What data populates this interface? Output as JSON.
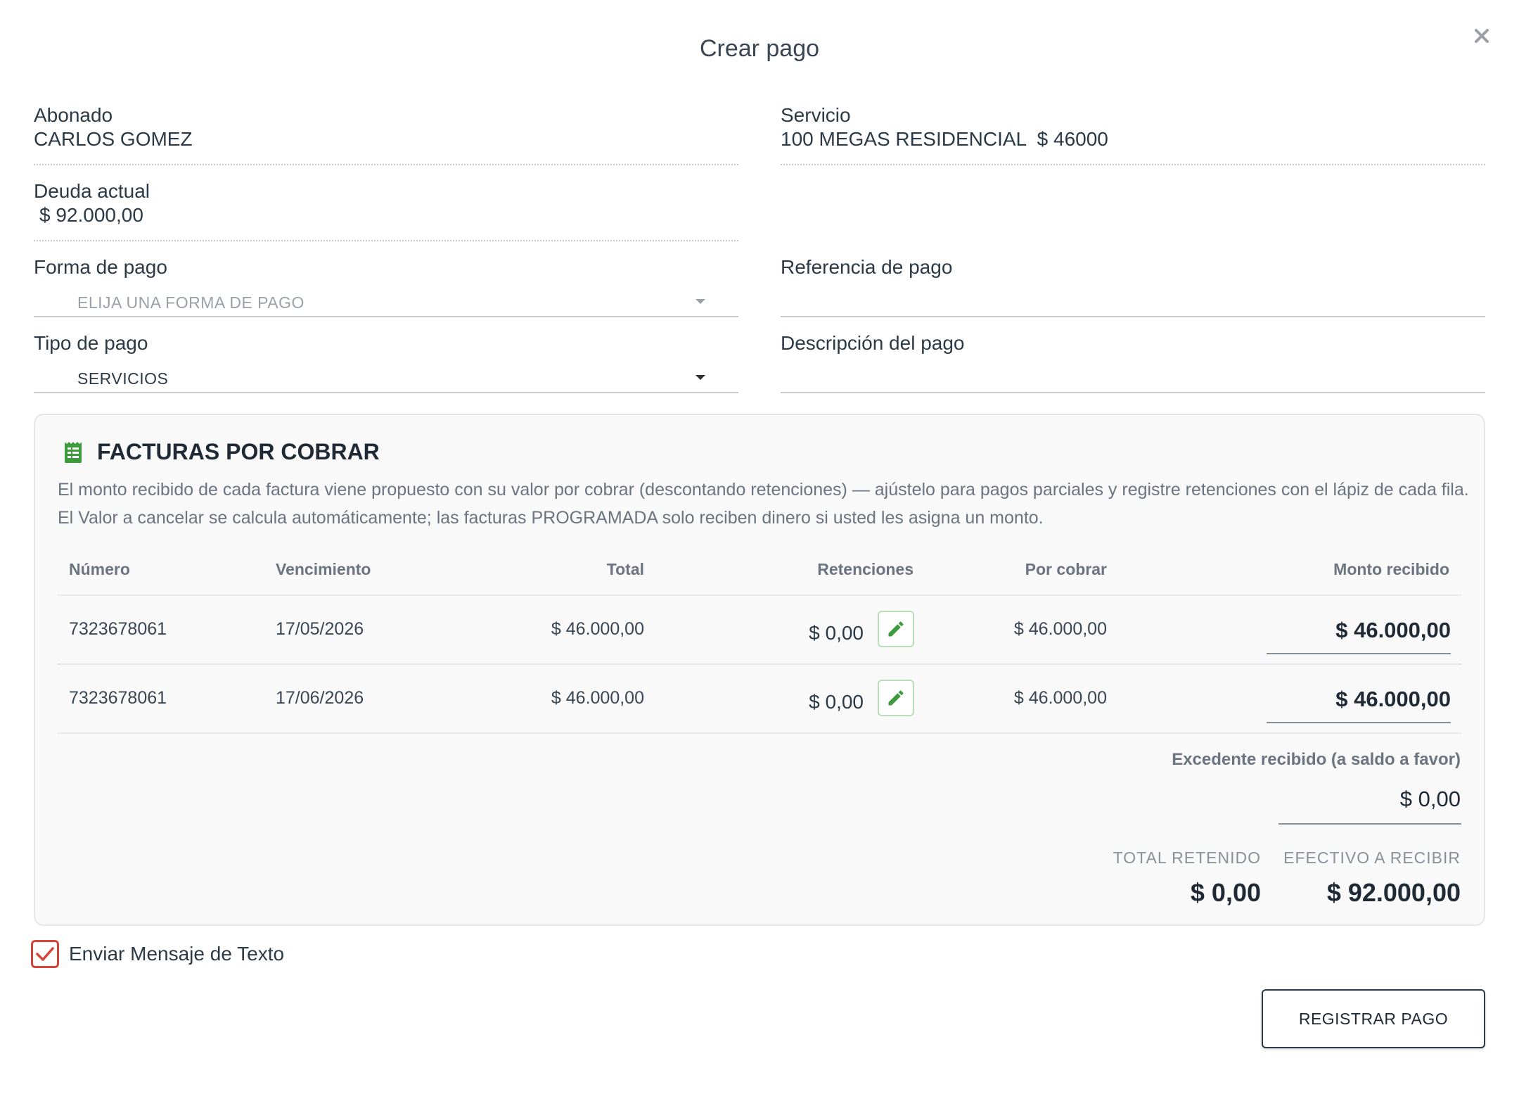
{
  "modal": {
    "title": "Crear pago"
  },
  "abonado": {
    "label": "Abonado",
    "value": "CARLOS GOMEZ"
  },
  "servicio": {
    "label": "Servicio",
    "value": "100 MEGAS RESIDENCIAL  $ 46000"
  },
  "deuda": {
    "label": "Deuda actual",
    "value": "$ 92.000,00"
  },
  "forma_pago": {
    "label": "Forma de pago",
    "placeholder": "ELIJA UNA FORMA DE PAGO"
  },
  "referencia": {
    "label": "Referencia de pago"
  },
  "tipo_pago": {
    "label": "Tipo de pago",
    "value": "SERVICIOS"
  },
  "descripcion": {
    "label": "Descripción del pago"
  },
  "facturas": {
    "title": "FACTURAS POR COBRAR",
    "description": "El monto recibido de cada factura viene propuesto con su valor por cobrar (descontando retenciones) — ajústelo para pagos parciales y registre retenciones con el lápiz de cada fila. El Valor a cancelar se calcula automáticamente; las facturas PROGRAMADA solo reciben dinero si usted les asigna un monto.",
    "columns": [
      "Número",
      "Vencimiento",
      "Total",
      "Retenciones",
      "Por cobrar",
      "Monto recibido"
    ],
    "rows": [
      {
        "numero": "7323678061",
        "vencimiento": "17/05/2026",
        "total": "$ 46.000,00",
        "retenciones": "$ 0,00",
        "por_cobrar": "$ 46.000,00",
        "monto": "$ 46.000,00"
      },
      {
        "numero": "7323678061",
        "vencimiento": "17/06/2026",
        "total": "$ 46.000,00",
        "retenciones": "$ 0,00",
        "por_cobrar": "$ 46.000,00",
        "monto": "$ 46.000,00"
      }
    ],
    "excedente_label": "Excedente recibido (a saldo a favor)",
    "excedente_value": "$ 0,00",
    "total_retenido_label": "TOTAL RETENIDO",
    "total_retenido_value": "$ 0,00",
    "efectivo_label": "EFECTIVO A RECIBIR",
    "efectivo_value": "$ 92.000,00"
  },
  "sms": {
    "label": "Enviar Mensaje de Texto",
    "checked": true
  },
  "submit": {
    "label": "REGISTRAR PAGO"
  },
  "colors": {
    "accent_green": "#3d9a3d",
    "check_red": "#d9443a"
  },
  "icons": {
    "close": "close-icon",
    "invoice": "receipt-icon",
    "edit": "pencil-icon",
    "check": "check-icon",
    "caret": "caret-down-icon"
  }
}
